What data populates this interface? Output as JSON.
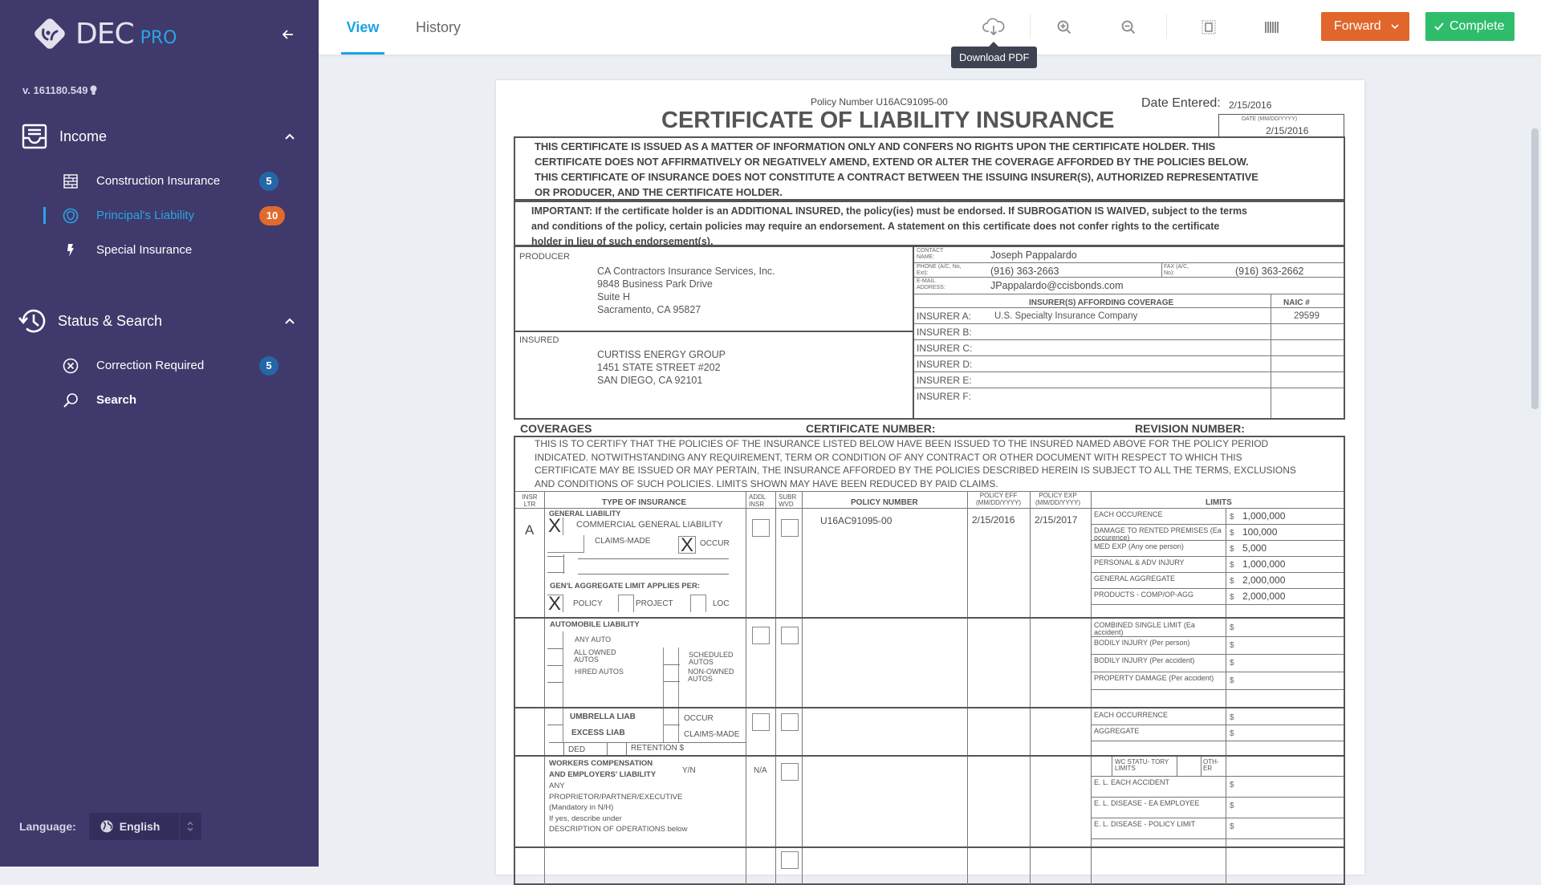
{
  "app": {
    "brand_main": "DEC",
    "brand_sub": "PRO",
    "version": "v. 161180.549",
    "colors": {
      "sidebar": "#3f3a6b",
      "accent": "#1aa3e6",
      "forward": "#e0662b",
      "complete": "#2fbd6c",
      "badge_blue": "#2467a8",
      "badge_orange": "#e06a2c"
    }
  },
  "sidebar": {
    "sections": [
      {
        "title": "Income",
        "icon": "inbox-icon",
        "expanded": true,
        "items": [
          {
            "label": "Construction Insurance",
            "icon": "brick-wall-icon",
            "badge": "5",
            "active": false
          },
          {
            "label": "Principal's Liability",
            "icon": "shield-icon",
            "badge": "10",
            "active": true
          },
          {
            "label": "Special Insurance",
            "icon": "lightning-icon",
            "badge": null,
            "active": false
          }
        ]
      },
      {
        "title": "Status & Search",
        "icon": "history-icon",
        "expanded": true,
        "items": [
          {
            "label": "Correction Required",
            "icon": "x-circle-icon",
            "badge": "5",
            "active": false
          },
          {
            "label": "Search",
            "icon": "search-icon",
            "badge": null,
            "active": false
          }
        ]
      }
    ],
    "language_label": "Language:",
    "language_value": "English"
  },
  "topbar": {
    "tabs": [
      {
        "label": "View",
        "active": true
      },
      {
        "label": "History",
        "active": false
      }
    ],
    "tools": [
      "download-pdf",
      "zoom-in",
      "zoom-out",
      "fit-page",
      "columns"
    ],
    "tooltip": "Download PDF",
    "forward_label": "Forward",
    "complete_label": "Complete"
  },
  "document": {
    "policy_number_line": "Policy Number U16AC91095-00",
    "date_entered_label": "Date Entered:",
    "date_entered_value": "2/15/2016",
    "title": "CERTIFICATE OF LIABILITY INSURANCE",
    "date_box_label": "DATE (MM/DD/YYYY)",
    "date_box_value": "2/15/2016",
    "disclaimer": [
      "THIS CERTIFICATE IS ISSUED AS A MATTER OF INFORMATION ONLY AND CONFERS NO RIGHTS UPON THE CERTIFICATE HOLDER. THIS",
      "CERTIFICATE DOES NOT AFFIRMATIVELY OR NEGATIVELY AMEND, EXTEND OR ALTER THE COVERAGE AFFORDED BY THE POLICIES BELOW.",
      "THIS CERTIFICATE OF INSURANCE DOES NOT CONSTITUTE A CONTRACT BETWEEN THE ISSUING INSURER(S), AUTHORIZED REPRESENTATIVE",
      "OR PRODUCER, AND THE CERTIFICATE HOLDER."
    ],
    "important": [
      "IMPORTANT: If the certificate holder is an ADDITIONAL INSURED, the policy(ies) must be endorsed. If SUBROGATION IS WAIVED, subject to the terms",
      "and conditions of the policy, certain policies may require an endorsement. A statement on this certificate does not confer rights to the certificate",
      "holder in lieu of such endorsement(s)."
    ],
    "producer": {
      "label": "PRODUCER",
      "lines": [
        "CA Contractors Insurance Services, Inc.",
        "9848 Business Park Drive",
        "Suite H",
        "Sacramento, CA  95827"
      ]
    },
    "insured": {
      "label": "INSURED",
      "lines": [
        "CURTISS ENERGY GROUP",
        "1451 STATE STREET #202",
        "SAN DIEGO, CA  92101"
      ]
    },
    "contact": {
      "name_label": "CONTACT NAME:",
      "name": "Joseph Pappalardo",
      "phone_label": "PHONE (A/C, No, Ext):",
      "phone": "(916) 363-2663",
      "fax_label": "FAX (A/C, No):",
      "fax": "(916) 363-2662",
      "email_label": "E-MAIL ADDRESS:",
      "email": "JPappalardo@ccisbonds.com"
    },
    "insurers_header": "INSURER(S) AFFORDING COVERAGE",
    "naic_header": "NAIC #",
    "insurers": [
      {
        "label": "INSURER A:",
        "name": "U.S. Specialty Insurance Company",
        "naic": "29599"
      },
      {
        "label": "INSURER B:",
        "name": "",
        "naic": ""
      },
      {
        "label": "INSURER C:",
        "name": "",
        "naic": ""
      },
      {
        "label": "INSURER D:",
        "name": "",
        "naic": ""
      },
      {
        "label": "INSURER E:",
        "name": "",
        "naic": ""
      },
      {
        "label": "INSURER F:",
        "name": "",
        "naic": ""
      }
    ],
    "coverages_label": "COVERAGES",
    "certificate_number_label": "CERTIFICATE NUMBER:",
    "revision_number_label": "REVISION NUMBER:",
    "certify_text": [
      "THIS IS TO CERTIFY THAT THE POLICIES OF THE INSURANCE LISTED BELOW HAVE BEEN ISSUED TO THE INSURED NAMED ABOVE FOR THE POLICY PERIOD",
      "INDICATED. NOTWITHSTANDING ANY REQUIREMENT, TERM OR CONDITION OF ANY CONTRACT OR OTHER DOCUMENT WITH RESPECT TO WHICH THIS",
      "CERTIFICATE MAY BE ISSUED OR MAY PERTAIN, THE INSURANCE AFFORDED BY THE POLICIES DESCRIBED HEREIN IS SUBJECT TO ALL THE TERMS, EXCLUSIONS",
      "AND CONDITIONS OF SUCH POLICIES. LIMITS SHOWN MAY HAVE BEEN REDUCED BY PAID CLAIMS."
    ],
    "table_headers": {
      "insr_ltr": "INSR LTR",
      "type": "TYPE OF INSURANCE",
      "addl": "ADDL INSR",
      "subr": "SUBR WVD",
      "policy_number": "POLICY NUMBER",
      "eff": "POLICY EFF (MM/DD/YYYY)",
      "exp": "POLICY EXP (MM/DD/YYYY)",
      "limits": "LIMITS"
    },
    "general_liability": {
      "insr_ltr": "A",
      "title": "GENERAL LIABILITY",
      "commercial": "COMMERCIAL GENERAL LIABILITY",
      "commercial_checked": true,
      "claims_made": "CLAIMS-MADE",
      "claims_made_checked": false,
      "occur": "OCCUR",
      "occur_checked": true,
      "aggregate_label": "GEN'L AGGREGATE LIMIT APPLIES PER:",
      "policy": "POLICY",
      "policy_checked": true,
      "project": "PROJECT",
      "loc": "LOC",
      "policy_number": "U16AC91095-00",
      "eff": "2/15/2016",
      "exp": "2/15/2017",
      "limits": [
        {
          "label": "EACH OCCURENCE",
          "value": "1,000,000"
        },
        {
          "label": "DAMAGE TO RENTED PREMISES (Ea occurence)",
          "value": "100,000"
        },
        {
          "label": "MED EXP (Any one person)",
          "value": "5,000"
        },
        {
          "label": "PERSONAL & ADV INJURY",
          "value": "1,000,000"
        },
        {
          "label": "GENERAL AGGREGATE",
          "value": "2,000,000"
        },
        {
          "label": "PRODUCTS - COMP/OP-AGG",
          "value": "2,000,000"
        }
      ]
    },
    "auto_liability": {
      "title": "AUTOMOBILE  LIABILITY",
      "any_auto": "ANY AUTO",
      "all_owned": "ALL OWNED AUTOS",
      "hired": "HIRED  AUTOS",
      "scheduled": "SCHEDULED AUTOS",
      "non_owned": "NON-OWNED AUTOS",
      "limits": [
        {
          "label": "COMBINED SINGLE LIMIT (Ea accident)",
          "value": ""
        },
        {
          "label": "BODILY INJURY (Per person)",
          "value": ""
        },
        {
          "label": "BODILY INJURY (Per accident)",
          "value": ""
        },
        {
          "label": "PROPERTY DAMAGE (Per accident)",
          "value": ""
        }
      ]
    },
    "umbrella": {
      "umbrella": "UMBRELLA  LIAB",
      "excess": "EXCESS  LIAB",
      "occur": "OCCUR",
      "claims_made": "CLAIMS-MADE",
      "ded": "DED",
      "retention": "RETENTION $",
      "limits": [
        {
          "label": "EACH OCCURRENCE",
          "value": ""
        },
        {
          "label": "AGGREGATE",
          "value": ""
        }
      ]
    },
    "workers_comp": {
      "title1": "WORKERS COMPENSATION",
      "title2": "AND EMPLOYERS' LIABILITY",
      "yn": "Y/N",
      "na": "N/A",
      "lines": [
        "ANY",
        "PROPRIETOR/PARTNER/EXECUTIVE",
        "(Mandatory in N/H)",
        "If yes,  describe under",
        "DESCRIPTION OF OPERATIONS below"
      ],
      "wc_statutory": "WC STATU- TORY LIMITS",
      "other": "OTH- ER",
      "limits": [
        {
          "label": "E. L. EACH ACCIDENT",
          "value": ""
        },
        {
          "label": "E. L. DISEASE - EA EMPLOYEE",
          "value": ""
        },
        {
          "label": "E. L. DISEASE - POLICY LIMIT",
          "value": ""
        }
      ]
    },
    "currency": "$"
  }
}
